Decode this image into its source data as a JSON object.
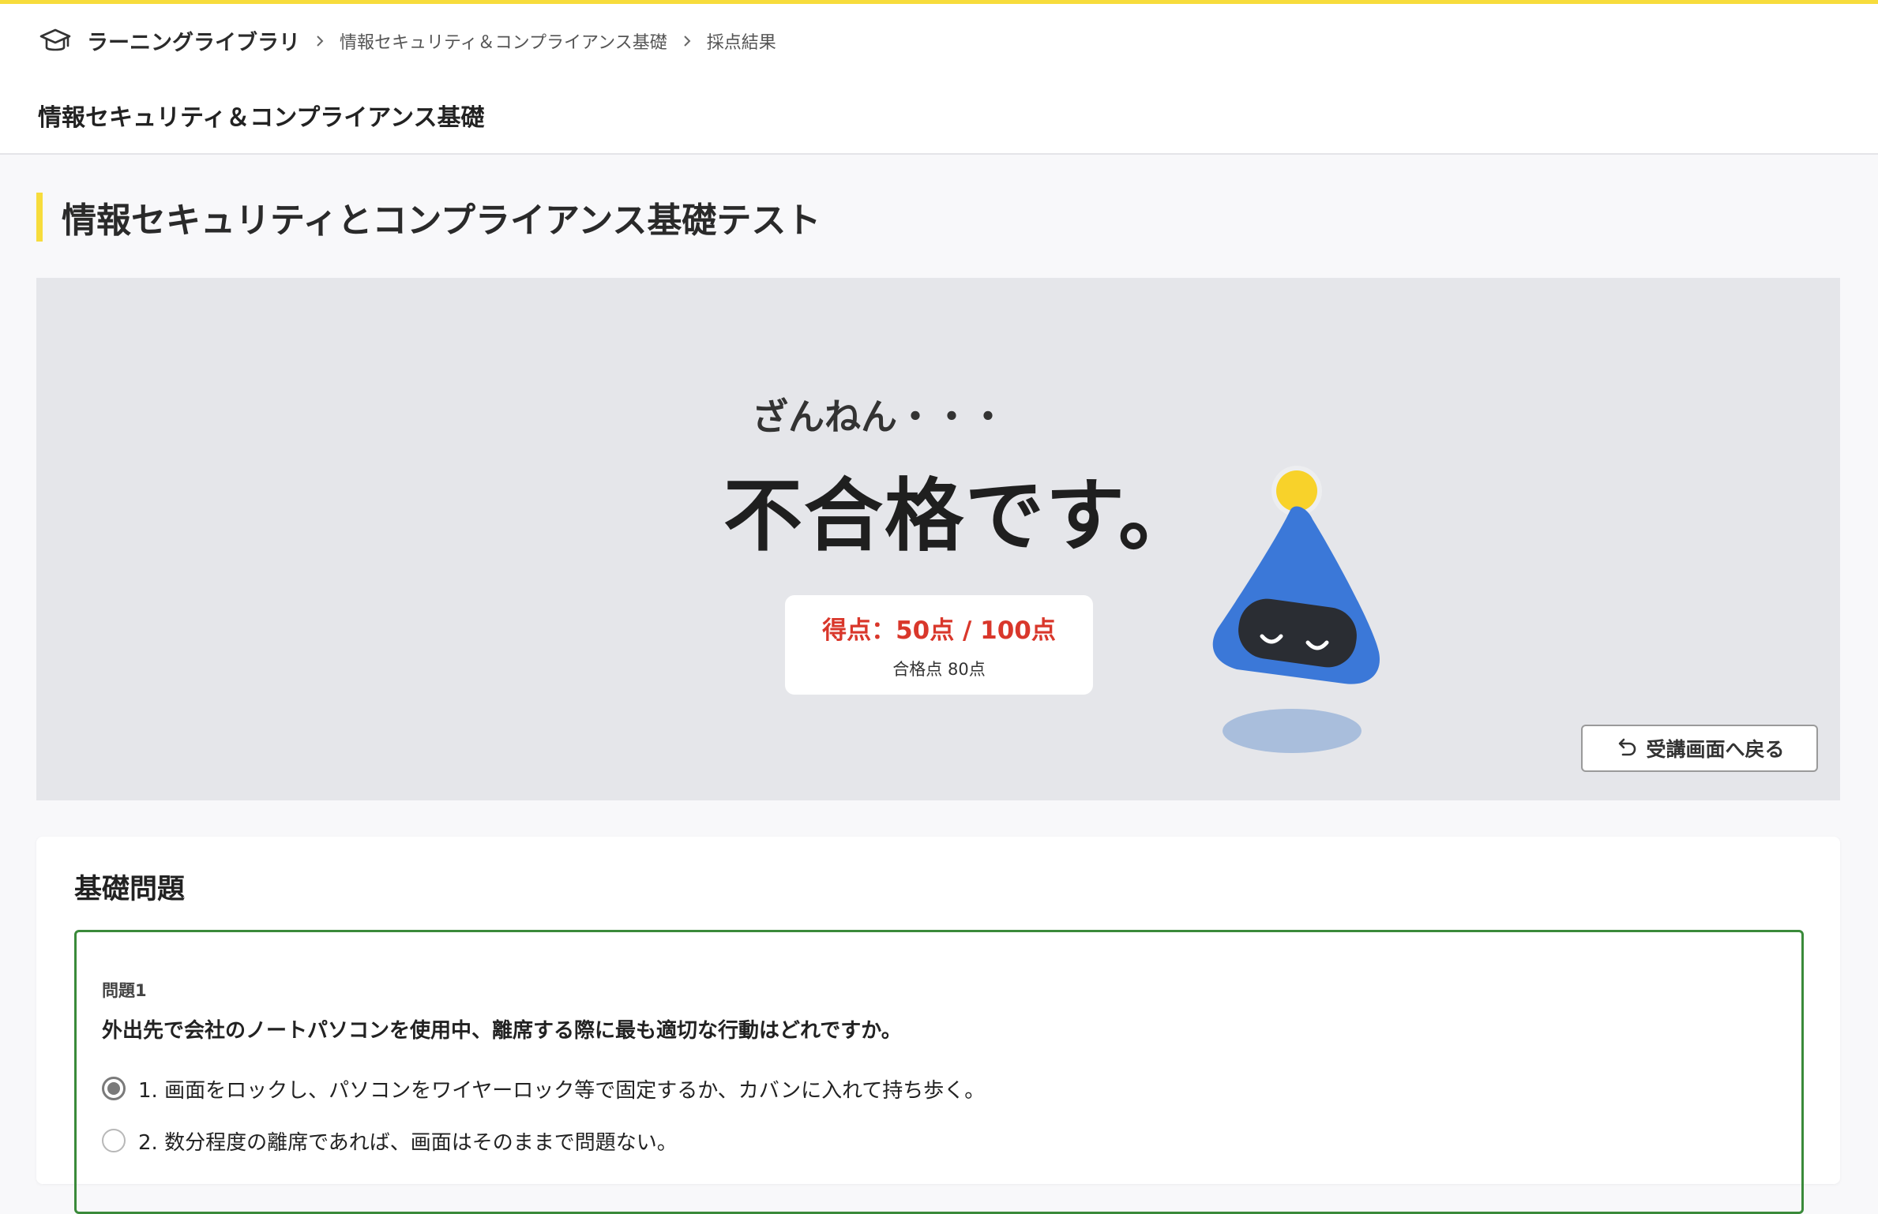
{
  "header": {
    "brand_icon": "graduation-cap-icon",
    "brand": "ラーニングライブラリ",
    "breadcrumb": [
      "情報セキュリティ＆コンプライアンス基礎",
      "採点結果"
    ],
    "accent_color": "#f7dc3c"
  },
  "course_title": "情報セキュリティ＆コンプライアンス基礎",
  "page_title": "情報セキュリティとコンプライアンス基礎テスト",
  "result": {
    "sub_message": "ざんねん・・・",
    "main_message": "不合格です。",
    "score": "得点：50点 / 100点",
    "pass_line": "合格点 80点",
    "score_color": "#d9372b",
    "back_label": "受講画面へ戻る",
    "back_icon": "undo-arrow-icon"
  },
  "section": {
    "title": "基礎問題",
    "question": {
      "number": "問題1",
      "text": "外出先で会社のノートパソコンを使用中、離席する際に最も適切な行動はどれですか。",
      "options": [
        "1. 画面をロックし、パソコンをワイヤーロック等で固定するか、カバンに入れて持ち歩く。",
        "2. 数分程度の離席であれば、画面はそのままで問題ない。"
      ],
      "selected_index": 0,
      "border_color": "#3a8a3a"
    }
  }
}
